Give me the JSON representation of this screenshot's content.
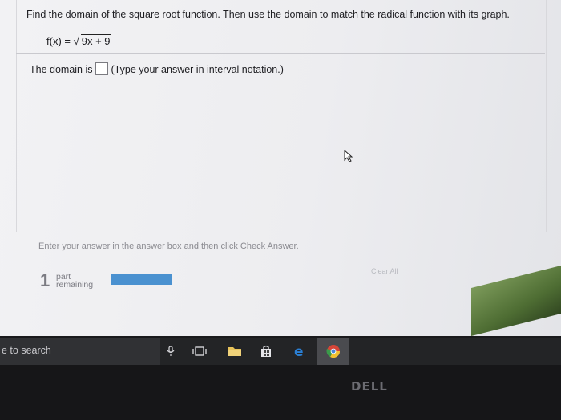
{
  "question": {
    "prompt": "Find the domain of the square root function. Then use the domain to match the radical function with its graph.",
    "function_lhs": "f(x) = ",
    "function_radicand": "9x + 9",
    "domain_label": "The domain is",
    "domain_value": "",
    "domain_hint": "(Type your answer in interval notation.)"
  },
  "footer": {
    "instruction": "Enter your answer in the answer box and then click Check Answer.",
    "parts_count": "1",
    "parts_label_1": "part",
    "parts_label_2": "remaining",
    "progress_fraction": 1.0,
    "clear_all_label": "Clear All"
  },
  "taskbar": {
    "search_text": "e to search",
    "icons": [
      "microphone-icon",
      "task-view-icon",
      "file-explorer-icon",
      "store-icon",
      "edge-icon",
      "chrome-icon"
    ]
  },
  "bezel": {
    "brand": "DELL"
  },
  "colors": {
    "progress_fill": "#4a91d0",
    "edge_blue": "#2a7fd4",
    "taskbar": "#232426"
  }
}
